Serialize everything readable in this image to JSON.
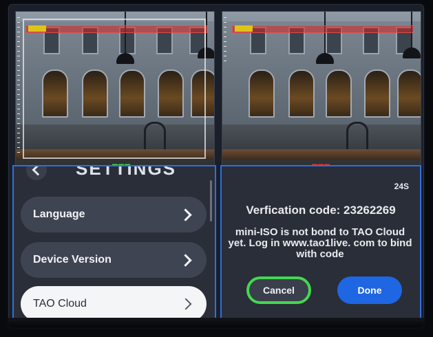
{
  "settings": {
    "title": "SETTINGS",
    "items": [
      {
        "label": "Language"
      },
      {
        "label": "Device Version"
      },
      {
        "label": "TAO Cloud"
      }
    ]
  },
  "dialog": {
    "countdown": "24S",
    "verification_line": "Verfication code: 23262269",
    "message": "mini-ISO is not bond to TAO Cloud yet. Log in www.tao1live. com to bind with code",
    "cancel_label": "Cancel",
    "done_label": "Done"
  },
  "colors": {
    "panel_border": "#2f6fe0",
    "focus_ring": "#43d84f",
    "done_button": "#1f66e3"
  }
}
